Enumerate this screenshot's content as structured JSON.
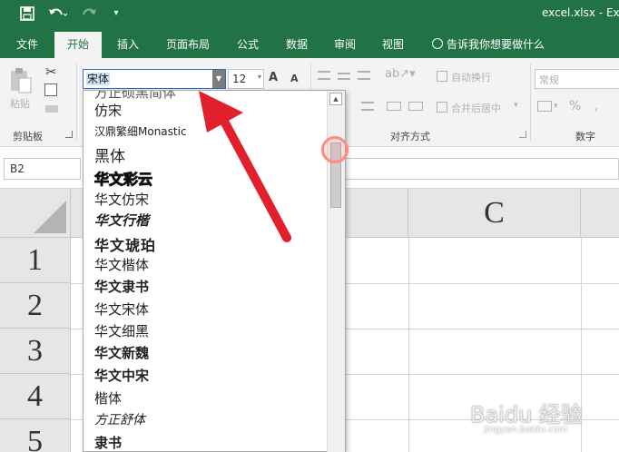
{
  "titlebar": {
    "doc_title": "excel.xlsx - Ex",
    "save_icon": "save-icon",
    "undo_icon": "undo-icon",
    "redo_icon": "redo-icon",
    "customize_icon": "customize-qat-icon"
  },
  "tabs": [
    "文件",
    "开始",
    "插入",
    "页面布局",
    "公式",
    "数据",
    "审阅",
    "视图"
  ],
  "active_tab": "开始",
  "tell_me": "告诉我你想要做什么",
  "ribbon": {
    "paste_label": "粘贴",
    "clipboard_group": "剪贴板",
    "font_name": "宋体",
    "font_size": "12",
    "grow_font": "A",
    "shrink_font": "A",
    "wrap_text": "自动换行",
    "merge_center": "合并后居中",
    "alignment_group": "对齐方式",
    "number_format": "常规",
    "number_group": "数字",
    "percent": "%"
  },
  "name_box": "B2",
  "grid": {
    "column_headers": [
      "C"
    ],
    "row_headers": [
      "1",
      "2",
      "3",
      "4",
      "5"
    ]
  },
  "font_list": {
    "items": [
      "方正硕黑简体",
      "仿宋",
      "汉鼎繁细Monastic",
      "黑体",
      "华文彩云",
      "华文仿宋",
      "华文行楷",
      "华文琥珀",
      "华文楷体",
      "华文隶书",
      "华文宋体",
      "华文细黑",
      "华文新魏",
      "华文中宋",
      "楷体",
      "方正舒体",
      "隶书"
    ]
  },
  "watermark": {
    "main": "Baidu 经验",
    "sub": "jingyan.baidu.com"
  },
  "colors": {
    "accent": "#217346",
    "ribbon_bg": "#f3f3f3",
    "arrow": "#e2202c"
  }
}
